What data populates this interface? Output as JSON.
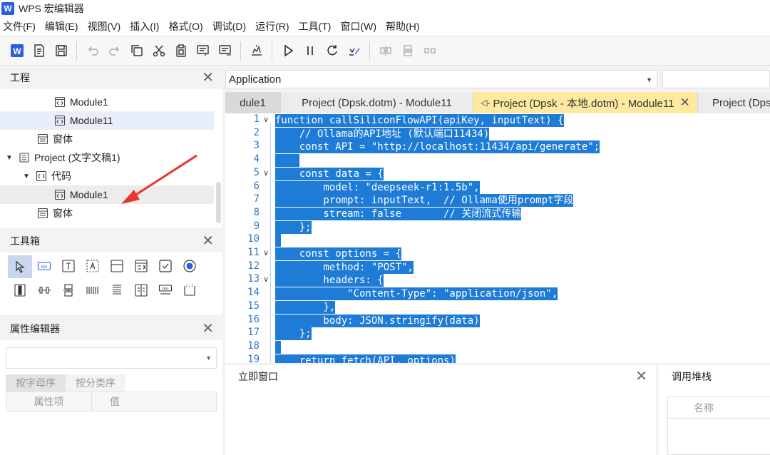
{
  "app": {
    "logo": "W",
    "title": "WPS 宏编辑器"
  },
  "menu": [
    "文件(F)",
    "编辑(E)",
    "视图(V)",
    "插入(I)",
    "格式(O)",
    "调试(D)",
    "运行(R)",
    "工具(T)",
    "窗口(W)",
    "帮助(H)"
  ],
  "toolbar_icons": [
    "wps-icon",
    "export-icon",
    "save-icon",
    "undo-icon",
    "redo-icon",
    "copy-icon",
    "cut-icon",
    "paste-icon",
    "comment-icon",
    "uncomment-icon",
    "debug-icon",
    "run-icon",
    "pause-icon",
    "reset-icon",
    "design-mode-icon",
    "align-left-icon",
    "align-center-icon",
    "align-right-icon"
  ],
  "project_panel": {
    "title": "工程",
    "items": [
      {
        "label": "Module1"
      },
      {
        "label": "Module11"
      },
      {
        "label": "窗体"
      },
      {
        "label": "Project (文字文稿1)"
      },
      {
        "label": "代码"
      },
      {
        "label": "Module1"
      },
      {
        "label": "窗体"
      }
    ]
  },
  "toolbox_panel": {
    "title": "工具箱"
  },
  "property_panel": {
    "title": "属性编辑器",
    "tabs": [
      "按字母序",
      "按分类序"
    ],
    "columns": [
      "属性项",
      "值"
    ]
  },
  "editor": {
    "object_combo": "Application",
    "tabs": [
      {
        "label": "dule1"
      },
      {
        "label": "Project (Dpsk.dotm) - Module11"
      },
      {
        "label": "Project (Dpsk - 本地.dotm) - Module11"
      },
      {
        "label": "Project (Dps"
      }
    ],
    "lines": [
      "function callSiliconFlowAPI(apiKey, inputText) {",
      "    // Ollama的API地址 (默认端口11434)",
      "    const API = \"http://localhost:11434/api/generate\";",
      "    ",
      "    const data = {",
      "        model: \"deepseek-r1:1.5b\",",
      "        prompt: inputText,  // Ollama使用prompt字段",
      "        stream: false       // 关闭流式传输",
      "    };",
      "",
      "    const options = {",
      "        method: \"POST\",",
      "        headers: {",
      "            \"Content-Type\": \"application/json\",",
      "        },",
      "        body: JSON.stringify(data)",
      "    };",
      "",
      "    return fetch(API, options)"
    ],
    "fold_lines": [
      1,
      5,
      11,
      13
    ]
  },
  "immediate_panel": {
    "title": "立即窗口"
  },
  "callstack_panel": {
    "title": "调用堆栈",
    "column": "名称"
  },
  "colors": {
    "selection": "#1e7bd6",
    "active_tab": "#fdeaa0",
    "annotation_arrow": "#e8352d"
  }
}
